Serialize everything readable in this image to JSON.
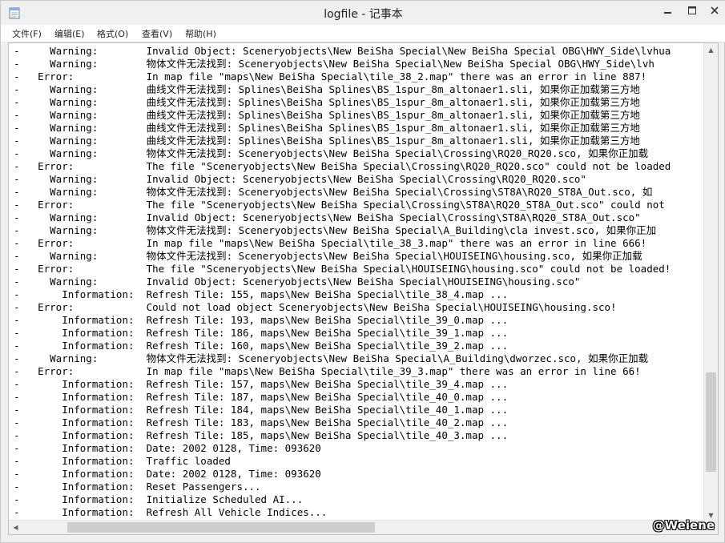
{
  "window": {
    "title": "logfile - 记事本",
    "icon": "notepad-icon"
  },
  "menu": [
    "文件(F)",
    "编辑(E)",
    "格式(O)",
    "查看(V)",
    "帮助(H)"
  ],
  "log_lines": [
    "-     Warning:        Invalid Object: Sceneryobjects\\New BeiSha Special\\New BeiSha Special OBG\\HWY_Side\\lvhua",
    "-     Warning:        物体文件无法找到: Sceneryobjects\\New BeiSha Special\\New BeiSha Special OBG\\HWY_Side\\lvh",
    "-   Error:            In map file \"maps\\New BeiSha Special\\tile_38_2.map\" there was an error in line 887!",
    "-     Warning:        曲线文件无法找到: Splines\\BeiSha Splines\\BS_1spur_8m_altonaer1.sli, 如果你正加载第三方地",
    "-     Warning:        曲线文件无法找到: Splines\\BeiSha Splines\\BS_1spur_8m_altonaer1.sli, 如果你正加载第三方地",
    "-     Warning:        曲线文件无法找到: Splines\\BeiSha Splines\\BS_1spur_8m_altonaer1.sli, 如果你正加载第三方地",
    "-     Warning:        曲线文件无法找到: Splines\\BeiSha Splines\\BS_1spur_8m_altonaer1.sli, 如果你正加载第三方地",
    "-     Warning:        曲线文件无法找到: Splines\\BeiSha Splines\\BS_1spur_8m_altonaer1.sli, 如果你正加载第三方地",
    "-     Warning:        物体文件无法找到: Sceneryobjects\\New BeiSha Special\\Crossing\\RQ20_RQ20.sco, 如果你正加载",
    "-   Error:            The file \"Sceneryobjects\\New BeiSha Special\\Crossing\\RQ20_RQ20.sco\" could not be loaded",
    "-     Warning:        Invalid Object: Sceneryobjects\\New BeiSha Special\\Crossing\\RQ20_RQ20.sco\"",
    "-     Warning:        物体文件无法找到: Sceneryobjects\\New BeiSha Special\\Crossing\\ST8A\\RQ20_ST8A_Out.sco, 如",
    "-   Error:            The file \"Sceneryobjects\\New BeiSha Special\\Crossing\\ST8A\\RQ20_ST8A_Out.sco\" could not",
    "-     Warning:        Invalid Object: Sceneryobjects\\New BeiSha Special\\Crossing\\ST8A\\RQ20_ST8A_Out.sco\"",
    "-     Warning:        物体文件无法找到: Sceneryobjects\\New BeiSha Special\\A_Building\\cla invest.sco, 如果你正加",
    "-   Error:            In map file \"maps\\New BeiSha Special\\tile_38_3.map\" there was an error in line 666!",
    "-     Warning:        物体文件无法找到: Sceneryobjects\\New BeiSha Special\\HOUISEING\\housing.sco, 如果你正加载",
    "-   Error:            The file \"Sceneryobjects\\New BeiSha Special\\HOUISEING\\housing.sco\" could not be loaded!",
    "-     Warning:        Invalid Object: Sceneryobjects\\New BeiSha Special\\HOUISEING\\housing.sco\"",
    "-       Information:  Refresh Tile: 155, maps\\New BeiSha Special\\tile_38_4.map ...",
    "-   Error:            Could not load object Sceneryobjects\\New BeiSha Special\\HOUISEING\\housing.sco!",
    "-       Information:  Refresh Tile: 193, maps\\New BeiSha Special\\tile_39_0.map ...",
    "-       Information:  Refresh Tile: 186, maps\\New BeiSha Special\\tile_39_1.map ...",
    "-       Information:  Refresh Tile: 160, maps\\New BeiSha Special\\tile_39_2.map ...",
    "-     Warning:        物体文件无法找到: Sceneryobjects\\New BeiSha Special\\A_Building\\dworzec.sco, 如果你正加载",
    "-   Error:            In map file \"maps\\New BeiSha Special\\tile_39_3.map\" there was an error in line 66!",
    "-       Information:  Refresh Tile: 157, maps\\New BeiSha Special\\tile_39_4.map ...",
    "-       Information:  Refresh Tile: 187, maps\\New BeiSha Special\\tile_40_0.map ...",
    "-       Information:  Refresh Tile: 184, maps\\New BeiSha Special\\tile_40_1.map ...",
    "-       Information:  Refresh Tile: 183, maps\\New BeiSha Special\\tile_40_2.map ...",
    "-       Information:  Refresh Tile: 185, maps\\New BeiSha Special\\tile_40_3.map ...",
    "-       Information:  Date: 2002 0128, Time: 093620",
    "-       Information:  Traffic loaded",
    "-       Information:  Date: 2002 0128, Time: 093620",
    "-       Information:  Reset Passengers...",
    "-       Information:  Initialize Scheduled AI...",
    "-       Information:  Refresh All Vehicle Indices..."
  ],
  "watermark": "@Weiene"
}
